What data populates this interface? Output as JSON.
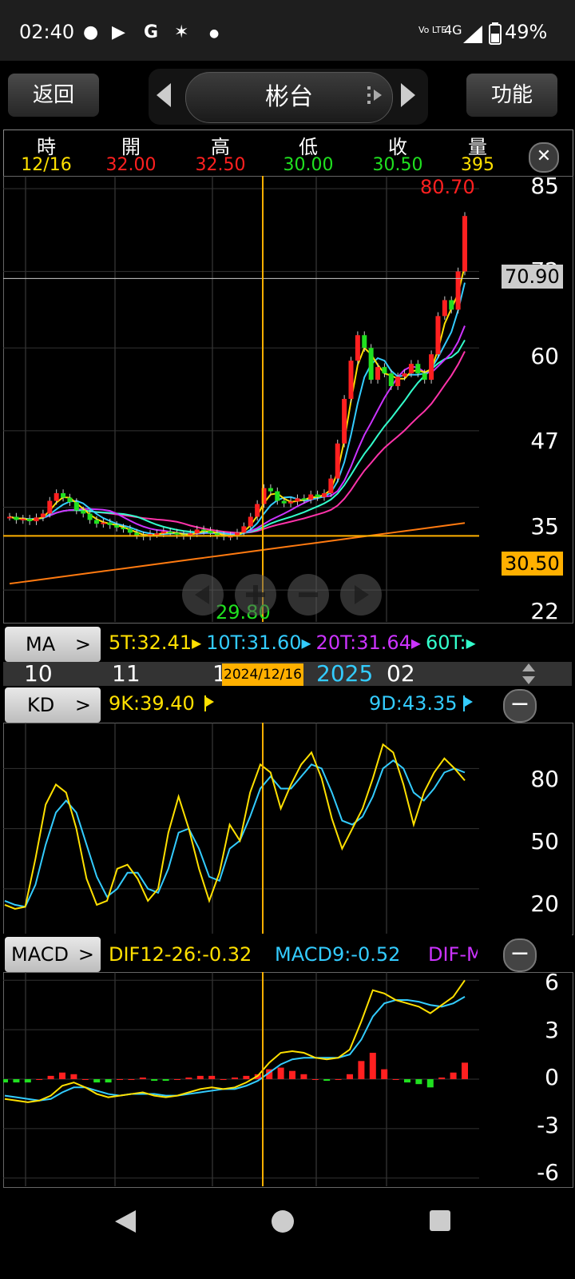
{
  "status_bar": {
    "time": "02:40",
    "network": "4G",
    "battery": "49%",
    "volte": "Vo LTE"
  },
  "header": {
    "back_label": "返回",
    "stock_name": "彬台",
    "function_label": "功能"
  },
  "quote": {
    "labels": [
      "時",
      "開",
      "高",
      "低",
      "收",
      "量"
    ],
    "values": [
      "12/16",
      "32.00",
      "32.50",
      "30.00",
      "30.50",
      "395"
    ],
    "colors": [
      "#ffe000",
      "#ff2020",
      "#ff2020",
      "#20e020",
      "#20e020",
      "#ffe000"
    ]
  },
  "price_panel": {
    "y_ticks": [
      "85",
      "72",
      "60",
      "47",
      "35",
      "22"
    ],
    "high_label": "80.70",
    "low_label": "29.80",
    "crosshair_price": "70.90",
    "current_price": "30.50"
  },
  "ma_bar": {
    "button": "MA",
    "items": [
      {
        "text": "5T:32.41",
        "color": "#ffe000"
      },
      {
        "text": "10T:31.60",
        "color": "#33ccff"
      },
      {
        "text": "20T:31.64",
        "color": "#cc33ff"
      },
      {
        "text": "60T:",
        "color": "#33ffcc"
      }
    ]
  },
  "time_axis": {
    "labels": [
      "10",
      "11",
      "1",
      "02"
    ],
    "selected_date": "2024/12/16",
    "year": "2025"
  },
  "kd_panel": {
    "button": "KD",
    "k_text": "9K:39.40",
    "d_text": "9D:43.35",
    "y_ticks": [
      "80",
      "50",
      "20"
    ]
  },
  "macd_panel": {
    "button": "MACD",
    "dif_text": "DIF12-26:-0.32",
    "macd_text": "MACD9:-0.52",
    "osc_text": "DIF-M",
    "y_ticks": [
      "6",
      "3",
      "0",
      "-3",
      "-6"
    ]
  },
  "chart_data": {
    "type": "candlestick",
    "note_series": "approximate close prices read from chart, Sep 2024 to Feb 2025",
    "close": [
      33.5,
      33.0,
      33.2,
      32.8,
      33.4,
      34.0,
      36.0,
      37.2,
      36.5,
      35.8,
      34.5,
      34.0,
      33.0,
      32.4,
      32.6,
      32.2,
      31.8,
      31.6,
      31.0,
      30.6,
      30.4,
      30.8,
      30.9,
      31.2,
      31.0,
      30.7,
      30.5,
      30.9,
      31.5,
      31.3,
      30.9,
      30.6,
      30.4,
      30.5,
      31.0,
      32.0,
      33.5,
      35.5,
      38.0,
      37.5,
      36.0,
      35.6,
      35.9,
      36.4,
      36.2,
      37.0,
      36.6,
      37.2,
      39.5,
      45.0,
      52.0,
      58.0,
      62.0,
      60.0,
      55.0,
      57.0,
      56.0,
      54.0,
      55.5,
      56.0,
      57.5,
      56.0,
      55.0,
      59.0,
      65.0,
      67.5,
      66.0,
      72.0,
      80.7
    ]
  }
}
